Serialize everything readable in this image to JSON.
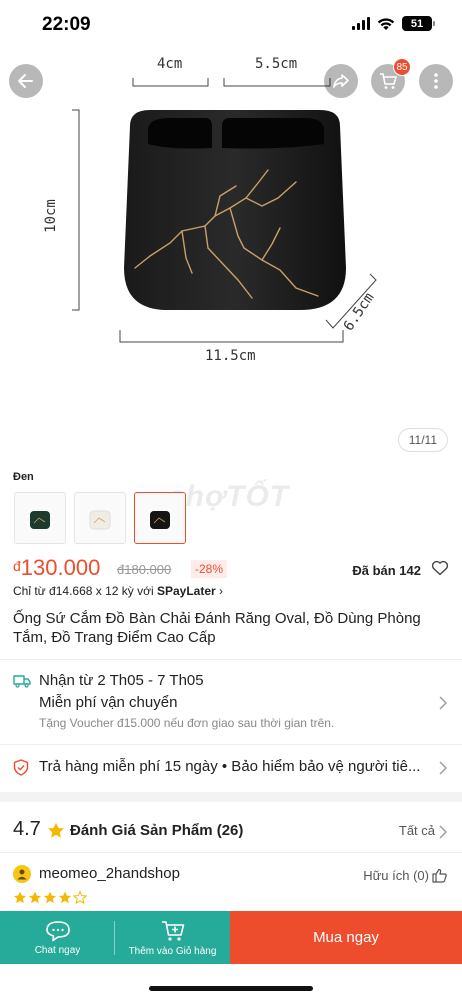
{
  "status": {
    "time": "22:09",
    "battery": "51"
  },
  "top_actions": {
    "cart_count": "85"
  },
  "product_image": {
    "dims": {
      "top_left": "4cm",
      "top_right": "5.5cm",
      "height": "10cm",
      "width": "11.5cm",
      "depth": "6.5cm"
    },
    "counter": "11/11"
  },
  "variants": {
    "title": "Đen",
    "selected_index": 2
  },
  "watermark": "chợTỐT",
  "price": {
    "currency": "đ",
    "current": "130.000",
    "original": "đ180.000",
    "discount": "-28%",
    "sold": "Đã bán 142",
    "installment_prefix": "Chỉ từ đ14.668 x 12 kỳ với ",
    "installment_brand": "SPayLater",
    "installment_suffix": " ›"
  },
  "product_name": "Ống Sứ Cắm Đồ Bàn Chải Đánh Răng Oval, Đồ Dùng Phòng Tắm, Đồ Trang Điểm Cao Cấp",
  "shipping": {
    "date": "Nhận từ 2 Th05 - 7 Th05",
    "free": "Miễn phí vận chuyển",
    "voucher": "Tặng Voucher đ15.000 nếu đơn giao sau thời gian trên."
  },
  "returns": {
    "text": "Trả hàng miễn phí 15 ngày  •  Bảo hiểm bảo vệ người tiê..."
  },
  "rating": {
    "score": "4.7",
    "title": "Đánh Giá Sản Phẩm (26)",
    "see_all": "Tất cả"
  },
  "review": {
    "user": "meomeo_2handshop",
    "helpful": "Hữu ích (0)",
    "stars": 4
  },
  "bottom_bar": {
    "chat": "Chat ngay",
    "add_cart": "Thêm vào Giỏ hàng",
    "buy": "Mua ngay"
  },
  "colors": {
    "accent": "#ee4d2d",
    "teal": "#26aa99"
  },
  "icons": [
    "back-arrow-icon",
    "share-icon",
    "cart-icon",
    "more-icon",
    "truck-icon",
    "shield-icon",
    "star-icon",
    "heart-icon",
    "chat-icon",
    "add-to-cart-icon",
    "chevron-right-icon"
  ]
}
